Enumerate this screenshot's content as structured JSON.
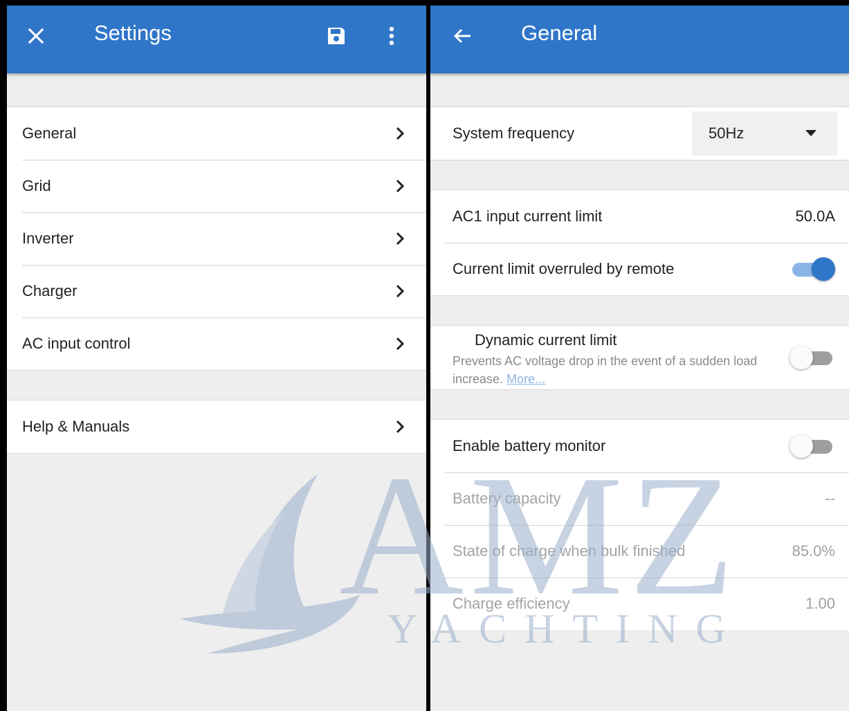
{
  "left": {
    "title": "Settings",
    "items": [
      {
        "label": "General"
      },
      {
        "label": "Grid"
      },
      {
        "label": "Inverter"
      },
      {
        "label": "Charger"
      },
      {
        "label": "AC input control"
      }
    ],
    "help": {
      "label": "Help & Manuals"
    }
  },
  "right": {
    "title": "General",
    "system_frequency": {
      "label": "System frequency",
      "value": "50Hz"
    },
    "ac1_limit": {
      "label": "AC1 input current limit",
      "value": "50.0A"
    },
    "overruled": {
      "label": "Current limit overruled by remote",
      "enabled": true
    },
    "dynamic": {
      "label": "Dynamic current limit",
      "description": "Prevents AC voltage drop in the event of a sudden load increase.",
      "more_link": "More...",
      "enabled": false
    },
    "battery_monitor": {
      "label": "Enable battery monitor",
      "enabled": false
    },
    "battery_capacity": {
      "label": "Battery capacity",
      "value": "--"
    },
    "soc_bulk": {
      "label": "State of charge when bulk finished",
      "value": "85.0%"
    },
    "charge_efficiency": {
      "label": "Charge efficiency",
      "value": "1.00"
    }
  },
  "watermark": {
    "letters": "AMZ",
    "sub": "YACHTING"
  },
  "colors": {
    "appbar": "#2f76c9",
    "background": "#eeeeee",
    "toggle_on": "#2f76c9",
    "link": "#8fb4e0"
  },
  "icons": [
    "close-icon",
    "save-icon",
    "more-vert-icon",
    "back-arrow-icon",
    "chevron-right-icon",
    "dropdown-caret-icon"
  ]
}
